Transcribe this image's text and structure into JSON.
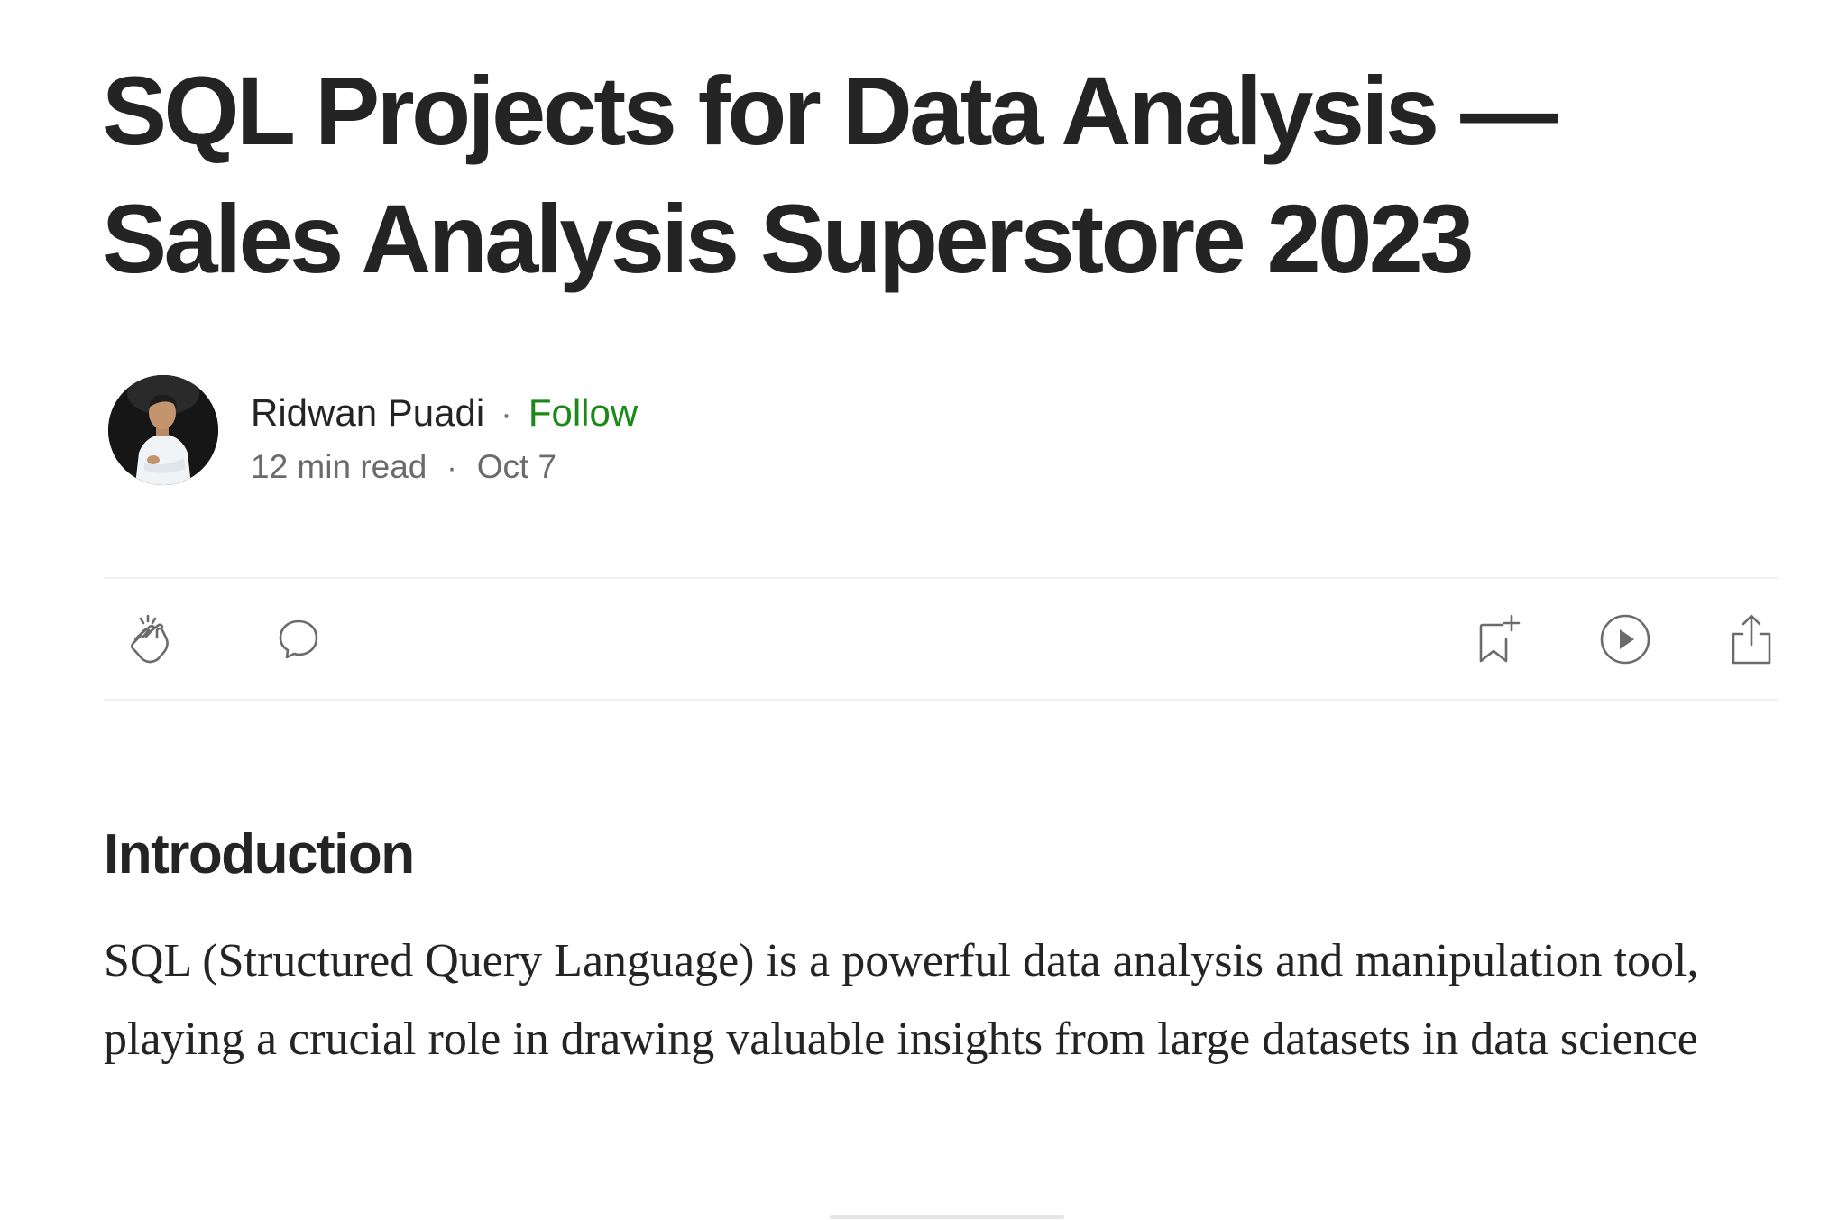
{
  "article": {
    "title": "SQL Projects for Data Analysis — Sales Analysis Superstore 2023"
  },
  "author": {
    "name": "Ridwan Puadi",
    "separator": "·",
    "follow_label": "Follow",
    "avatar_icon": "author-photo"
  },
  "meta": {
    "read_time": "12 min read",
    "separator": "·",
    "date": "Oct 7"
  },
  "actions": {
    "left": [
      "clap-icon",
      "comment-icon"
    ],
    "right": [
      "bookmark-add-icon",
      "listen-play-icon",
      "share-icon"
    ]
  },
  "content": {
    "heading": "Introduction",
    "paragraph": "SQL (Structured Query Language) is a powerful data analysis and manipulation tool, playing a crucial role in drawing valuable insights from large datasets in data science"
  },
  "colors": {
    "text": "#242424",
    "muted": "#6b6b6b",
    "follow": "#1a8917",
    "divider": "#f0f0f0"
  }
}
